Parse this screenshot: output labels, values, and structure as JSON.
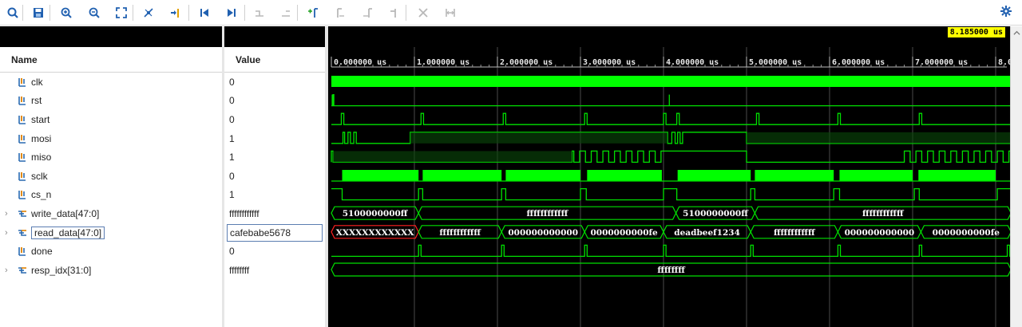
{
  "toolbar": {
    "icons": [
      "search-icon",
      "save-icon",
      "zoom-in-icon",
      "zoom-out-icon",
      "zoom-fit-icon",
      "goto-cursor-icon",
      "marker-icon",
      "go-to-start-icon",
      "go-to-end-icon",
      "previous-transition-icon",
      "next-transition-icon",
      "add-marker-icon",
      "previous-marker-icon",
      "next-marker-icon",
      "swap-cursors-icon",
      "cut-icon",
      "expand-icon"
    ],
    "settings_icon": "gear-icon"
  },
  "columns": {
    "name": "Name",
    "value": "Value"
  },
  "cursor": {
    "label": "8.185000 us",
    "color": "#ffff00"
  },
  "signals": [
    {
      "name": "clk",
      "value": "0",
      "kind": "bit"
    },
    {
      "name": "rst",
      "value": "0",
      "kind": "bit"
    },
    {
      "name": "start",
      "value": "0",
      "kind": "bit"
    },
    {
      "name": "mosi",
      "value": "1",
      "kind": "bit"
    },
    {
      "name": "miso",
      "value": "1",
      "kind": "bit"
    },
    {
      "name": "sclk",
      "value": "0",
      "kind": "bit"
    },
    {
      "name": "cs_n",
      "value": "1",
      "kind": "bit"
    },
    {
      "name": "write_data[47:0]",
      "value": "ffffffffffff",
      "kind": "bus"
    },
    {
      "name": "read_data[47:0]",
      "value": "cafebabe5678",
      "kind": "bus",
      "selected": true
    },
    {
      "name": "done",
      "value": "0",
      "kind": "bit"
    },
    {
      "name": "resp_idx[31:0]",
      "value": "ffffffff",
      "kind": "bus"
    }
  ],
  "timeline": {
    "ticks": [
      "0.000000 us",
      "1.000000 us",
      "2.000000 us",
      "3.000000 us",
      "4.000000 us",
      "5.000000 us",
      "6.000000 us",
      "7.000000 us",
      "8.0"
    ],
    "end_us": 8.185
  },
  "buses": {
    "write_data": [
      {
        "from": 0.0,
        "to": 1.05,
        "label": "5100000000ff"
      },
      {
        "from": 1.05,
        "to": 4.15,
        "label": "ffffffffffff"
      },
      {
        "from": 4.15,
        "to": 5.1,
        "label": "5100000000ff"
      },
      {
        "from": 5.1,
        "to": 8.185,
        "label": "ffffffffffff"
      }
    ],
    "read_data": [
      {
        "from": 0.0,
        "to": 1.05,
        "label": "XXXXXXXXXXXX",
        "unknown": true
      },
      {
        "from": 1.05,
        "to": 2.05,
        "label": "ffffffffffff"
      },
      {
        "from": 2.05,
        "to": 3.05,
        "label": "000000000000"
      },
      {
        "from": 3.05,
        "to": 4.0,
        "label": "0000000000fe"
      },
      {
        "from": 4.0,
        "to": 5.05,
        "label": "deadbeef1234"
      },
      {
        "from": 5.05,
        "to": 6.1,
        "label": "ffffffffffff"
      },
      {
        "from": 6.1,
        "to": 7.1,
        "label": "000000000000"
      },
      {
        "from": 7.1,
        "to": 8.185,
        "label": "0000000000fe"
      }
    ],
    "resp_idx": [
      {
        "from": 0.0,
        "to": 8.185,
        "label": "ffffffff"
      }
    ]
  },
  "colors": {
    "wave": "#00e000",
    "wave_fill": "#00ff00",
    "unknown": "#ff2020",
    "grid": "#4a4a4a"
  }
}
